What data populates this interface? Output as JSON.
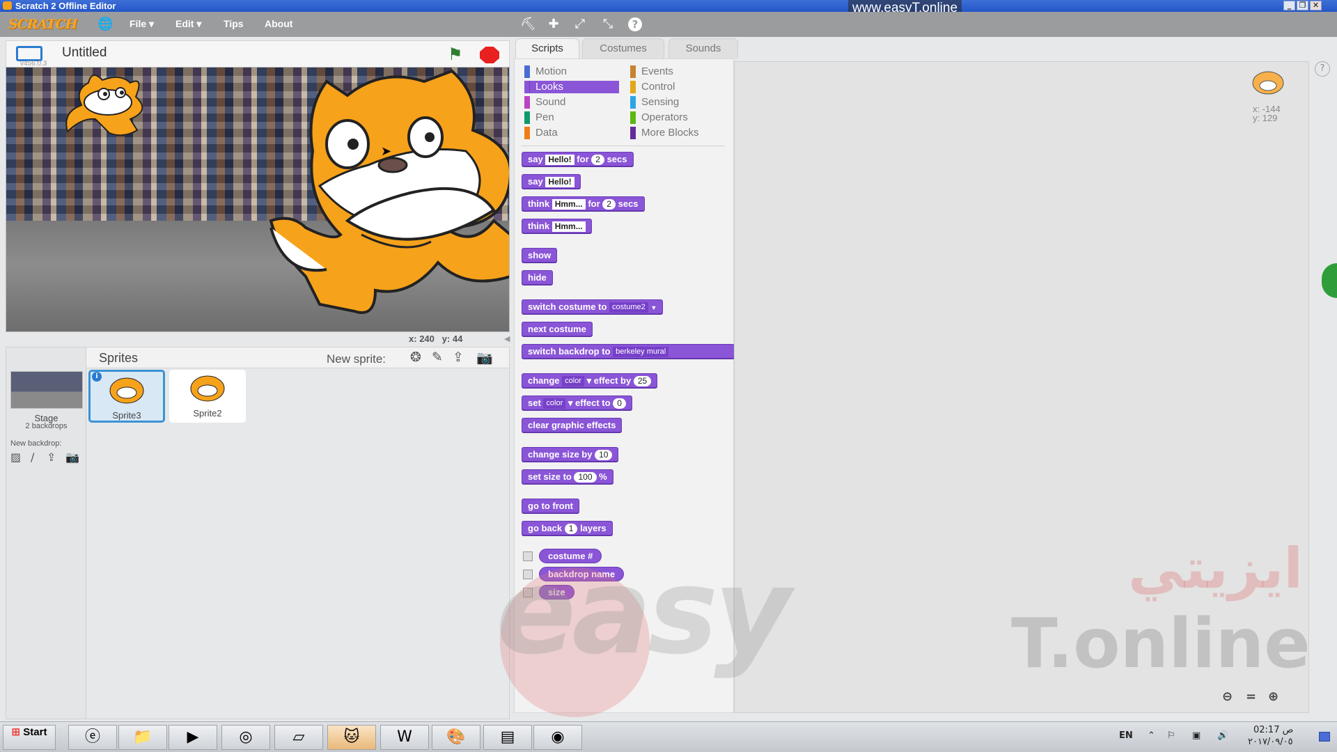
{
  "window": {
    "title": "Scratch 2 Offline Editor",
    "watermark_url": "www.easyT.online"
  },
  "menubar": {
    "logo": "SCRATCH",
    "items": [
      "File ▾",
      "Edit ▾",
      "Tips",
      "About"
    ]
  },
  "stage": {
    "project_title": "Untitled",
    "version": "v456.0.3",
    "mouse_x_label": "x:",
    "mouse_x": "240",
    "mouse_y_label": "y:",
    "mouse_y": "44"
  },
  "sprites_panel": {
    "title": "Sprites",
    "new_sprite_label": "New sprite:",
    "stage_label": "Stage",
    "stage_backdrops": "2 backdrops",
    "new_backdrop_label": "New backdrop:",
    "sprites": [
      {
        "name": "Sprite3",
        "selected": true
      },
      {
        "name": "Sprite2",
        "selected": false
      }
    ]
  },
  "tabs": [
    {
      "label": "Scripts",
      "active": true
    },
    {
      "label": "Costumes",
      "active": false
    },
    {
      "label": "Sounds",
      "active": false
    }
  ],
  "categories": [
    {
      "label": "Motion",
      "color": "#4a6cd4"
    },
    {
      "label": "Looks",
      "color": "#8a55d7",
      "selected": true
    },
    {
      "label": "Sound",
      "color": "#bb42c3"
    },
    {
      "label": "Pen",
      "color": "#0e9a6c"
    },
    {
      "label": "Data",
      "color": "#ee7d16"
    },
    {
      "label": "Events",
      "color": "#c88330"
    },
    {
      "label": "Control",
      "color": "#e1a91a"
    },
    {
      "label": "Sensing",
      "color": "#2ca5e2"
    },
    {
      "label": "Operators",
      "color": "#5cb712"
    },
    {
      "label": "More Blocks",
      "color": "#632d99"
    }
  ],
  "blocks": {
    "say_for": {
      "w1": "say",
      "v1": "Hello!",
      "w2": "for",
      "v2": "2",
      "w3": "secs"
    },
    "say": {
      "w1": "say",
      "v1": "Hello!"
    },
    "think_for": {
      "w1": "think",
      "v1": "Hmm...",
      "w2": "for",
      "v2": "2",
      "w3": "secs"
    },
    "think": {
      "w1": "think",
      "v1": "Hmm..."
    },
    "show": "show",
    "hide": "hide",
    "switch_costume": {
      "w1": "switch costume to",
      "v1": "costume2"
    },
    "next_costume": "next costume",
    "switch_backdrop": {
      "w1": "switch backdrop to",
      "v1": "berkeley mural"
    },
    "change_effect": {
      "w1": "change",
      "v1": "color",
      "w2": "effect by",
      "v2": "25"
    },
    "set_effect": {
      "w1": "set",
      "v1": "color",
      "w2": "effect to",
      "v2": "0"
    },
    "clear_effects": "clear graphic effects",
    "change_size": {
      "w1": "change size by",
      "v1": "10"
    },
    "set_size": {
      "w1": "set size to",
      "v1": "100",
      "w2": "%"
    },
    "go_front": "go to front",
    "go_back": {
      "w1": "go back",
      "v1": "1",
      "w2": "layers"
    },
    "rep_costume": "costume #",
    "rep_backdrop": "backdrop name",
    "rep_size": "size"
  },
  "script_area": {
    "sprite_x": "x: -144",
    "sprite_y": "y: 129"
  },
  "brand_watermark": {
    "latin": "easy",
    "suffix": "T.online",
    "arabic": "ايزيتي"
  },
  "taskbar": {
    "start": "Start",
    "lang": "EN",
    "time": "02:17 ص",
    "date": "٢٠١٧/٠٩/٠٥"
  }
}
